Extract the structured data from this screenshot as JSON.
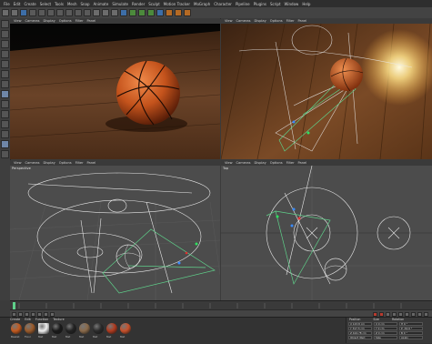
{
  "menubar": {
    "items": [
      "File",
      "Edit",
      "Create",
      "Select",
      "Tools",
      "Mesh",
      "Snap",
      "Animate",
      "Simulate",
      "Render",
      "Sculpt",
      "Motion Tracker",
      "MoGraph",
      "Character",
      "Pipeline",
      "Plugins",
      "Script",
      "Window",
      "Help"
    ]
  },
  "viewports": {
    "perspective_render": {
      "menu": [
        "View",
        "Cameras",
        "Display",
        "Options",
        "Filter",
        "Panel"
      ]
    },
    "camera": {
      "menu": [
        "View",
        "Cameras",
        "Display",
        "Options",
        "Filter",
        "Panel"
      ]
    },
    "perspective": {
      "name": "Perspective",
      "menu": [
        "View",
        "Cameras",
        "Display",
        "Options",
        "Filter",
        "Panel"
      ]
    },
    "top": {
      "name": "Top",
      "menu": [
        "View",
        "Cameras",
        "Display",
        "Options",
        "Filter",
        "Panel"
      ]
    }
  },
  "materials": {
    "tabs": [
      "Create",
      "Edit",
      "Function",
      "Texture"
    ],
    "swatches": [
      {
        "label": "Basket",
        "color": "#c45a1e"
      },
      {
        "label": "Floor",
        "color": "#9a5a2a"
      },
      {
        "label": "Mat",
        "color": "#f0f0f0"
      },
      {
        "label": "Mat",
        "color": "#1a1a1a"
      },
      {
        "label": "Mat",
        "color": "#222222"
      },
      {
        "label": "Mat",
        "color": "#8a6a4a"
      },
      {
        "label": "Mat",
        "color": "#2a2a2a"
      },
      {
        "label": "Mat",
        "color": "#b03a1e"
      },
      {
        "label": "Mat",
        "color": "#c8502a"
      }
    ]
  },
  "attributes": {
    "headers": [
      "Position",
      "Size",
      "Rotation"
    ],
    "rows": [
      [
        "X 143.8 cm",
        "X 0 cm",
        "H 0 °"
      ],
      [
        "Y 317.5 cm",
        "Y 0 cm",
        "P -34.9 °"
      ],
      [
        "Z 424.78 cm",
        "Z 0 cm",
        "B 0 °"
      ],
      [
        "Object (Rel)",
        "Size",
        "Apply"
      ]
    ]
  },
  "colors": {
    "accent": "#3d6ea8",
    "ball": "#c0561e",
    "wire_white": "#e8e8e8",
    "wire_green": "#5fd08a",
    "light": "#fff6c8"
  }
}
